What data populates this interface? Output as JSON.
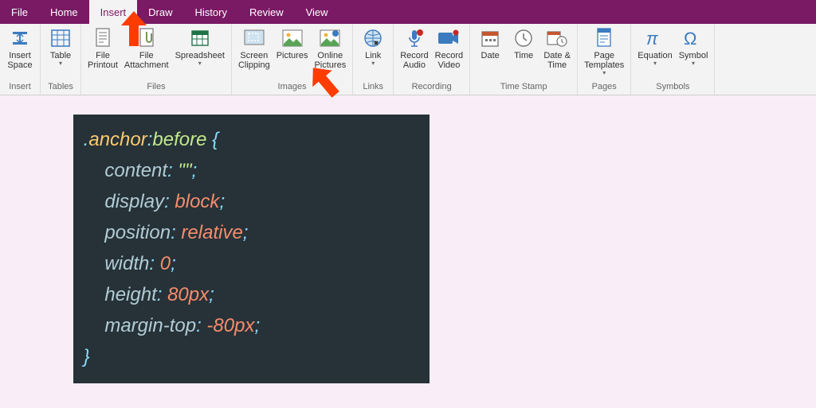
{
  "menubar": {
    "tabs": [
      {
        "label": "File"
      },
      {
        "label": "Home"
      },
      {
        "label": "Insert"
      },
      {
        "label": "Draw"
      },
      {
        "label": "History"
      },
      {
        "label": "Review"
      },
      {
        "label": "View"
      }
    ],
    "active_index": 2
  },
  "ribbon": {
    "groups": [
      {
        "title": "Insert",
        "commands": [
          {
            "id": "insert-space",
            "label": "Insert\nSpace",
            "icon": "insert-space-icon"
          }
        ]
      },
      {
        "title": "Tables",
        "commands": [
          {
            "id": "table",
            "label": "Table",
            "icon": "table-icon",
            "dropdown": true
          }
        ]
      },
      {
        "title": "Files",
        "commands": [
          {
            "id": "file-printout",
            "label": "File\nPrintout",
            "icon": "file-printout-icon"
          },
          {
            "id": "file-attachment",
            "label": "File\nAttachment",
            "icon": "file-attachment-icon"
          },
          {
            "id": "spreadsheet",
            "label": "Spreadsheet",
            "icon": "spreadsheet-icon",
            "dropdown": true
          }
        ]
      },
      {
        "title": "Images",
        "commands": [
          {
            "id": "screen-clipping",
            "label": "Screen\nClipping",
            "icon": "screen-clipping-icon"
          },
          {
            "id": "pictures",
            "label": "Pictures",
            "icon": "pictures-icon"
          },
          {
            "id": "online-pictures",
            "label": "Online\nPictures",
            "icon": "online-pictures-icon"
          }
        ]
      },
      {
        "title": "Links",
        "commands": [
          {
            "id": "link",
            "label": "Link",
            "icon": "link-icon",
            "dropdown": true
          }
        ]
      },
      {
        "title": "Recording",
        "commands": [
          {
            "id": "record-audio",
            "label": "Record\nAudio",
            "icon": "record-audio-icon"
          },
          {
            "id": "record-video",
            "label": "Record\nVideo",
            "icon": "record-video-icon"
          }
        ]
      },
      {
        "title": "Time Stamp",
        "commands": [
          {
            "id": "date",
            "label": "Date",
            "icon": "date-icon"
          },
          {
            "id": "time",
            "label": "Time",
            "icon": "time-icon"
          },
          {
            "id": "date-time",
            "label": "Date &\nTime",
            "icon": "date-time-icon"
          }
        ]
      },
      {
        "title": "Pages",
        "commands": [
          {
            "id": "page-templates",
            "label": "Page\nTemplates",
            "icon": "page-templates-icon",
            "dropdown": true
          }
        ]
      },
      {
        "title": "Symbols",
        "commands": [
          {
            "id": "equation",
            "label": "Equation",
            "icon": "equation-icon",
            "dropdown": true
          },
          {
            "id": "symbol",
            "label": "Symbol",
            "icon": "symbol-icon",
            "dropdown": true
          }
        ]
      }
    ]
  },
  "code": {
    "selector_dot": ".",
    "selector_class": "anchor",
    "selector_pseudo_colon": ":",
    "selector_pseudo": "before",
    "open_brace": " {",
    "props": [
      {
        "name": "content",
        "colon": ":",
        "value": "\"\"",
        "semi": ";",
        "value_class": "t-str"
      },
      {
        "name": "display",
        "colon": ":",
        "value": "block",
        "semi": ";",
        "value_class": "t-val"
      },
      {
        "name": "position",
        "colon": ":",
        "value": "relative",
        "semi": ";",
        "value_class": "t-val"
      },
      {
        "name": "width",
        "colon": ":",
        "value": "0",
        "semi": ";",
        "value_class": "t-val"
      },
      {
        "name": "height",
        "colon": ":",
        "value": "80px",
        "semi": ";",
        "value_class": "t-val"
      },
      {
        "name": "margin-top",
        "colon": ":",
        "value": "-80px",
        "semi": ";",
        "value_class": "t-val"
      }
    ],
    "close_brace": "}"
  }
}
